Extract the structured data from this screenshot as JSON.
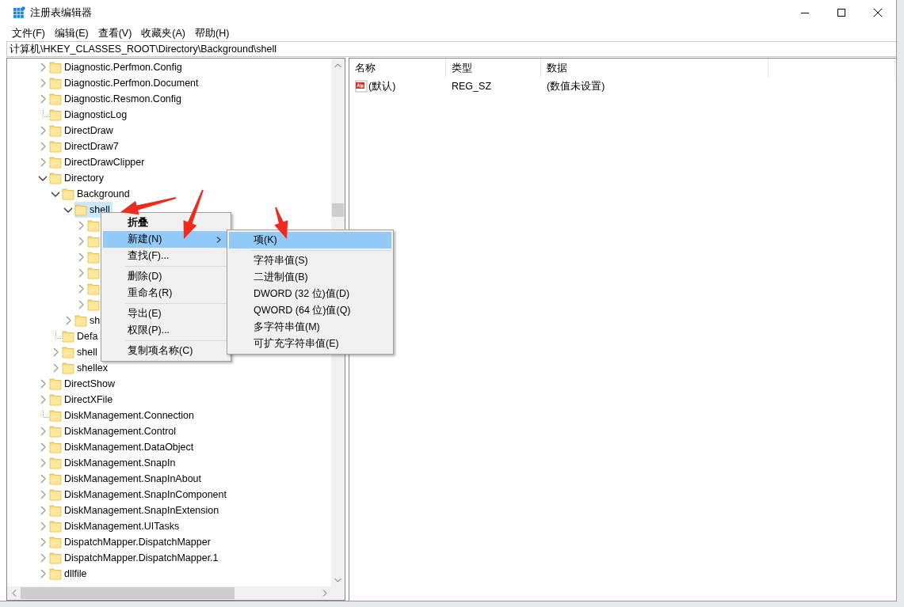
{
  "window": {
    "title": "注册表编辑器"
  },
  "menu_bar": [
    "文件(F)",
    "编辑(E)",
    "查看(V)",
    "收藏夹(A)",
    "帮助(H)"
  ],
  "address": "计算机\\HKEY_CLASSES_ROOT\\Directory\\Background\\shell",
  "tree": [
    {
      "label": "Diagnostic.Perfmon.Config",
      "kind": "collapsed",
      "selected": false
    },
    {
      "label": "Diagnostic.Perfmon.Document",
      "kind": "collapsed",
      "selected": false
    },
    {
      "label": "Diagnostic.Resmon.Config",
      "kind": "collapsed",
      "selected": false
    },
    {
      "label": "DiagnosticLog",
      "kind": "leaf",
      "selected": false
    },
    {
      "label": "DirectDraw",
      "kind": "collapsed",
      "selected": false
    },
    {
      "label": "DirectDraw7",
      "kind": "collapsed",
      "selected": false
    },
    {
      "label": "DirectDrawClipper",
      "kind": "collapsed",
      "selected": false
    },
    {
      "label": "Directory",
      "kind": "expanded",
      "selected": false,
      "children": [
        {
          "label": "Background",
          "kind": "expanded",
          "selected": false,
          "children": [
            {
              "label": "shell",
              "kind": "expanded",
              "selected": true,
              "children": [
                {
                  "kind": "collapsed",
                  "selected": false
                },
                {
                  "kind": "collapsed",
                  "selected": false
                },
                {
                  "kind": "collapsed",
                  "selected": false
                },
                {
                  "kind": "collapsed",
                  "selected": false
                },
                {
                  "kind": "collapsed",
                  "selected": false
                },
                {
                  "kind": "collapsed",
                  "selected": false
                }
              ]
            },
            {
              "label": "sh",
              "kind": "collapsed",
              "selected": false
            }
          ]
        },
        {
          "label": "Defa",
          "kind": "leaf",
          "selected": false
        },
        {
          "label": "shell",
          "kind": "collapsed",
          "selected": false
        },
        {
          "label": "shellex",
          "kind": "collapsed",
          "selected": false
        }
      ]
    },
    {
      "label": "DirectShow",
      "kind": "collapsed",
      "selected": false
    },
    {
      "label": "DirectXFile",
      "kind": "collapsed",
      "selected": false
    },
    {
      "label": "DiskManagement.Connection",
      "kind": "leaf",
      "selected": false
    },
    {
      "label": "DiskManagement.Control",
      "kind": "collapsed",
      "selected": false
    },
    {
      "label": "DiskManagement.DataObject",
      "kind": "collapsed",
      "selected": false
    },
    {
      "label": "DiskManagement.SnapIn",
      "kind": "collapsed",
      "selected": false
    },
    {
      "label": "DiskManagement.SnapInAbout",
      "kind": "collapsed",
      "selected": false
    },
    {
      "label": "DiskManagement.SnapInComponent",
      "kind": "collapsed",
      "selected": false
    },
    {
      "label": "DiskManagement.SnapInExtension",
      "kind": "collapsed",
      "selected": false
    },
    {
      "label": "DiskManagement.UITasks",
      "kind": "collapsed",
      "selected": false
    },
    {
      "label": "DispatchMapper.DispatchMapper",
      "kind": "collapsed",
      "selected": false
    },
    {
      "label": "DispatchMapper.DispatchMapper.1",
      "kind": "collapsed",
      "selected": false
    },
    {
      "label": "dllfile",
      "kind": "collapsed",
      "selected": false
    }
  ],
  "values_table": {
    "columns": [
      "名称",
      "类型",
      "数据"
    ],
    "rows": [
      {
        "name": "(默认)",
        "type": "REG_SZ",
        "data": "(数值未设置)"
      }
    ]
  },
  "context_menu": {
    "items": [
      {
        "kind": "item",
        "label": "折叠",
        "default": true,
        "selected": false,
        "has_submenu": false
      },
      {
        "kind": "item",
        "label": "新建(N)",
        "default": false,
        "selected": true,
        "has_submenu": true
      },
      {
        "kind": "item",
        "label": "查找(F)...",
        "default": false,
        "selected": false,
        "has_submenu": false
      },
      {
        "kind": "separator"
      },
      {
        "kind": "item",
        "label": "删除(D)",
        "default": false,
        "selected": false,
        "has_submenu": false
      },
      {
        "kind": "item",
        "label": "重命名(R)",
        "default": false,
        "selected": false,
        "has_submenu": false
      },
      {
        "kind": "separator"
      },
      {
        "kind": "item",
        "label": "导出(E)",
        "default": false,
        "selected": false,
        "has_submenu": false
      },
      {
        "kind": "item",
        "label": "权限(P)...",
        "default": false,
        "selected": false,
        "has_submenu": false
      },
      {
        "kind": "separator"
      },
      {
        "kind": "item",
        "label": "复制项名称(C)",
        "default": false,
        "selected": false,
        "has_submenu": false
      }
    ]
  },
  "submenu": {
    "items": [
      {
        "kind": "item",
        "label": "项(K)",
        "default": false,
        "selected": true,
        "has_submenu": false
      },
      {
        "kind": "separator"
      },
      {
        "kind": "item",
        "label": "字符串值(S)",
        "default": false,
        "selected": false,
        "has_submenu": false
      },
      {
        "kind": "item",
        "label": "二进制值(B)",
        "default": false,
        "selected": false,
        "has_submenu": false
      },
      {
        "kind": "item",
        "label": "DWORD (32 位)值(D)",
        "default": false,
        "selected": false,
        "has_submenu": false
      },
      {
        "kind": "item",
        "label": "QWORD (64 位)值(Q)",
        "default": false,
        "selected": false,
        "has_submenu": false
      },
      {
        "kind": "item",
        "label": "多字符串值(M)",
        "default": false,
        "selected": false,
        "has_submenu": false
      },
      {
        "kind": "item",
        "label": "可扩充字符串值(E)",
        "default": false,
        "selected": false,
        "has_submenu": false
      }
    ]
  }
}
